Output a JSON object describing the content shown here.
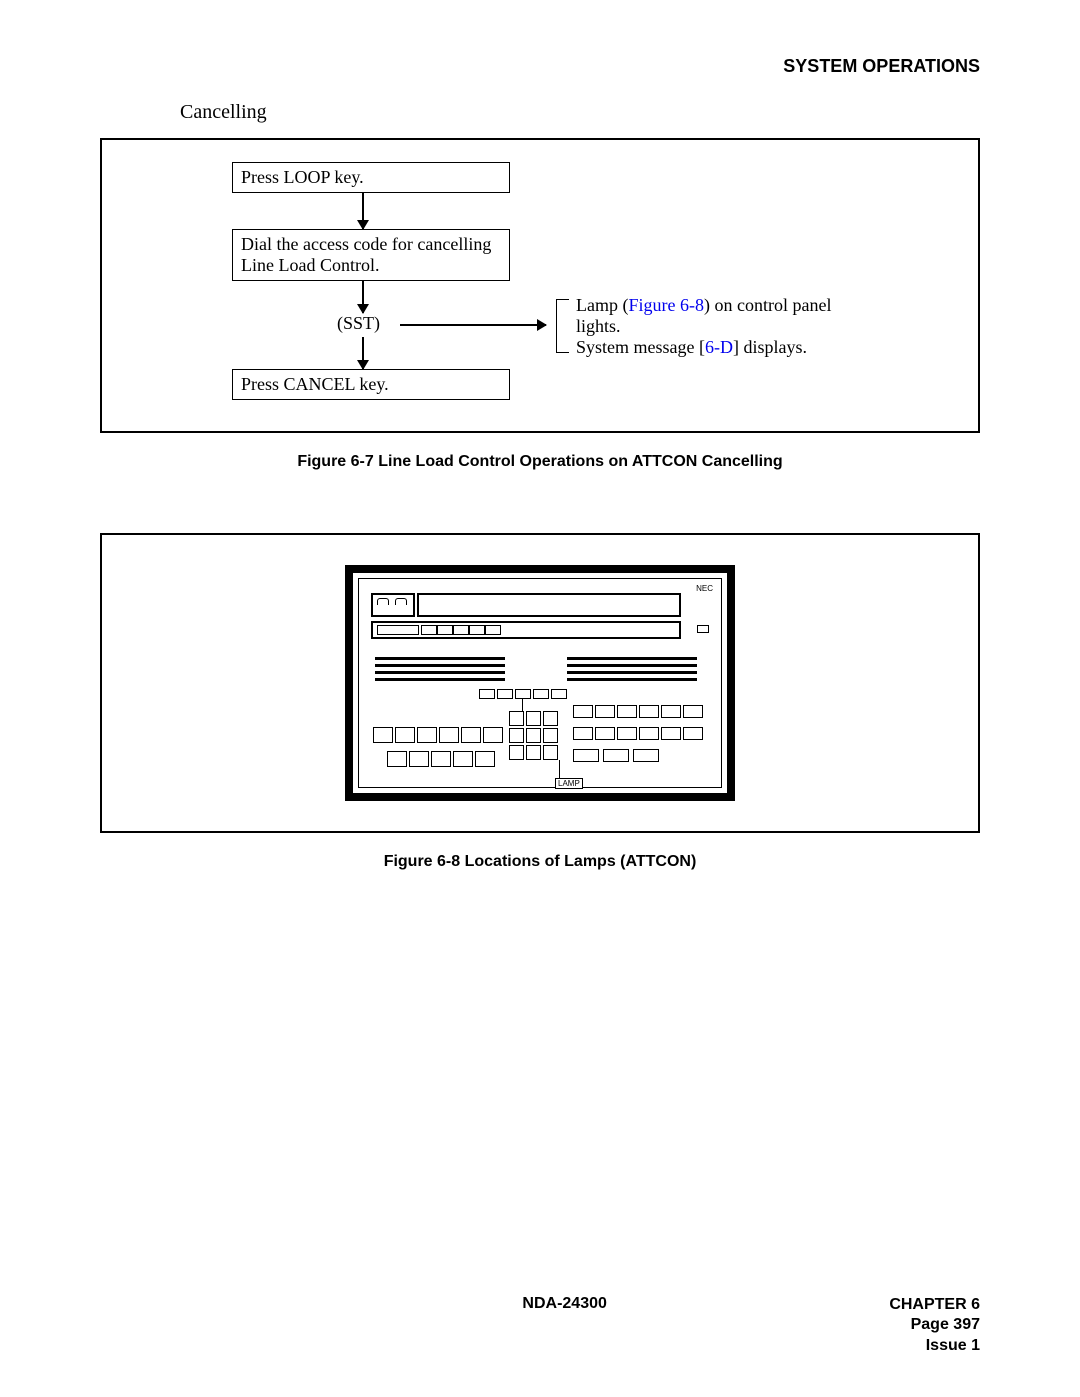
{
  "header": "SYSTEM OPERATIONS",
  "subsection": "Cancelling",
  "flow": {
    "step1": "Press LOOP key.",
    "step2": "Dial the access code for cancelling Line Load Control.",
    "sst": "(SST)",
    "note_pre": "Lamp (",
    "note_link1": "Figure 6-8",
    "note_mid": ") on control panel lights.",
    "note2_pre": "System message [",
    "note2_link": "6-D",
    "note2_post": "] displays.",
    "step3": "Press CANCEL key."
  },
  "caption1": "Figure 6-7   Line Load Control Operations on ATTCON    Cancelling",
  "caption2": "Figure 6-8   Locations of Lamps (ATTCON)",
  "panel": {
    "brand": "NEC",
    "lamp": "LAMP"
  },
  "footer": {
    "doc": "NDA-24300",
    "chapter": "CHAPTER 6",
    "page": "Page 397",
    "issue": "Issue 1"
  }
}
